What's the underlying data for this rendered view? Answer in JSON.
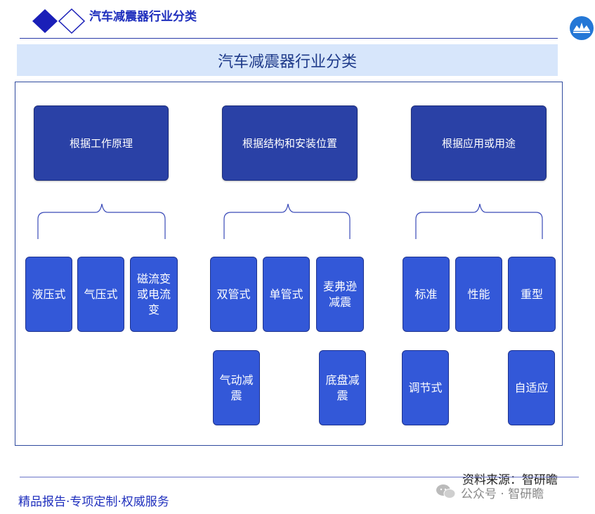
{
  "header": {
    "title": "汽车减震器行业分类"
  },
  "banner": {
    "title": "汽车减震器行业分类"
  },
  "categories": [
    {
      "label": "根据工作原理",
      "items": [
        "液压式",
        "气压式",
        "磁流变或电流变"
      ]
    },
    {
      "label": "根据结构和安装位置",
      "items": [
        "双管式",
        "单管式",
        "麦弗逊减震",
        "气动减震",
        "底盘减震"
      ]
    },
    {
      "label": "根据应用或用途",
      "items": [
        "标准",
        "性能",
        "重型",
        "调节式",
        "自适应"
      ]
    }
  ],
  "footer": {
    "slogan": "精品报告·专项定制·权威服务",
    "source": "资料来源：智研瞻",
    "watermark": "公众号 · 智研瞻"
  },
  "colors": {
    "category": "#2a41a6",
    "leaf": "#3358d8",
    "brand": "#1f2fbd",
    "banner": "#d7e6fb"
  }
}
